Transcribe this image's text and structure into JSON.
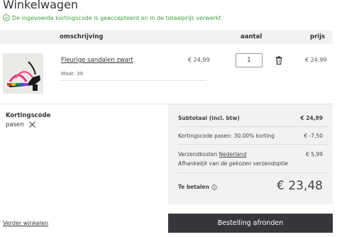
{
  "page": {
    "title": "Winkelwagen",
    "notice": "De ingevoerde kortingscode is geaccepteerd en in de totaalprijs verwerkt."
  },
  "table": {
    "headers": {
      "description": "omschrijving",
      "quantity": "aantal",
      "price": "prijs"
    }
  },
  "product": {
    "name": "Fleurige sandalen zwart",
    "size": "Maat: 39",
    "unit_price": "€ 24,99",
    "quantity": "1",
    "total": "€ 24,99"
  },
  "coupon": {
    "title": "Kortingscode",
    "code": "pasen"
  },
  "summary": {
    "subtotal_label": "Subtotaal (incl. btw)",
    "subtotal_value": "€ 24,99",
    "discount_label": "Kortingscode pasen: 30.00% korting",
    "discount_value": "€ -7,50",
    "shipping_label": "Verzendkosten",
    "shipping_country": "Nederland",
    "shipping_value": "€ 5,99",
    "shipping_note": "Afhankelijk van de gekozen verzendoptie",
    "total_label": "Te betalen",
    "total_value": "€ 23,48"
  },
  "actions": {
    "continue_label": "Verder winkelen",
    "checkout_label": "Bestelling afronden"
  },
  "colors": {
    "success": "#3a9d3a",
    "button": "#35373d",
    "panel": "#f2f2f2"
  },
  "icons": [
    "check-circle-icon",
    "trash-icon",
    "close-icon",
    "info-circle-icon"
  ]
}
